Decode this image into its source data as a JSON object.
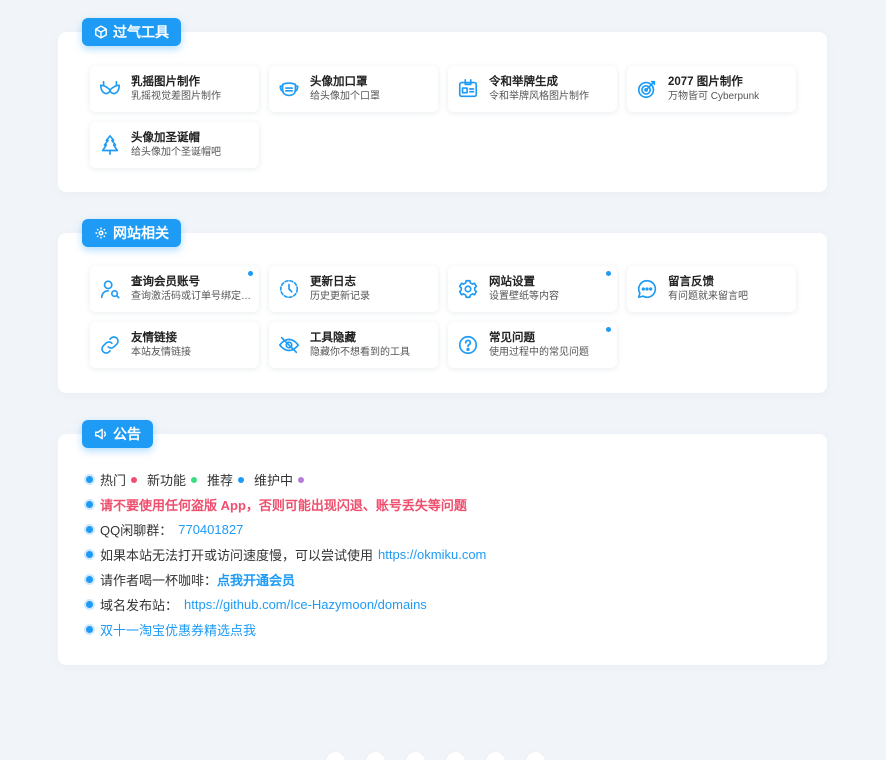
{
  "sections": {
    "tools": {
      "title": "过气工具",
      "items": [
        {
          "title": "乳摇图片制作",
          "desc": "乳摇视觉差图片制作",
          "icon": "bra-icon"
        },
        {
          "title": "头像加口罩",
          "desc": "给头像加个口罩",
          "icon": "mask-icon"
        },
        {
          "title": "令和举牌生成",
          "desc": "令和举牌风格图片制作",
          "icon": "id-card-icon"
        },
        {
          "title": "2077 图片制作",
          "desc": "万物皆可 Cyberpunk",
          "icon": "target-icon"
        },
        {
          "title": "头像加圣诞帽",
          "desc": "给头像加个圣诞帽吧",
          "icon": "christmas-tree-icon"
        }
      ]
    },
    "site": {
      "title": "网站相关",
      "items": [
        {
          "title": "查询会员账号",
          "desc": "查询激活码或订单号绑定的账号",
          "icon": "user-search-icon"
        },
        {
          "title": "更新日志",
          "desc": "历史更新记录",
          "icon": "clock-icon"
        },
        {
          "title": "网站设置",
          "desc": "设置壁纸等内容",
          "icon": "gear-icon"
        },
        {
          "title": "留言反馈",
          "desc": "有问题就来留言吧",
          "icon": "chat-icon"
        },
        {
          "title": "友情链接",
          "desc": "本站友情链接",
          "icon": "link-icon"
        },
        {
          "title": "工具隐藏",
          "desc": "隐藏你不想看到的工具",
          "icon": "eye-off-icon"
        },
        {
          "title": "常见问题",
          "desc": "使用过程中的常见问题",
          "icon": "question-icon"
        }
      ]
    },
    "notice": {
      "title": "公告",
      "legend": [
        {
          "label": "热门",
          "color": "#ef4f6e"
        },
        {
          "label": "新功能",
          "color": "#3ddc84"
        },
        {
          "label": "推荐",
          "color": "#1e9bf5"
        },
        {
          "label": "维护中",
          "color": "#b57bd6"
        }
      ],
      "warning": "请不要使用任何盗版 App，否则可能出现闪退、账号丢失等问题",
      "qq_label": "QQ闲聊群：",
      "qq_number": "770401827",
      "mirror_text": "如果本站无法打开或访问速度慢，可以尝试使用",
      "mirror_url": "https://okmiku.com",
      "coffee_text": "请作者喝一杯咖啡：",
      "coffee_link": "点我开通会员",
      "domain_label": "域名发布站：",
      "domain_url": "https://github.com/Ice-Hazymoon/domains",
      "taobao": "双十一淘宝优惠券精选点我"
    }
  },
  "colors": {
    "accent": "#1e9bf5",
    "danger": "#ef4f6e",
    "background": "#f1f5f9"
  }
}
